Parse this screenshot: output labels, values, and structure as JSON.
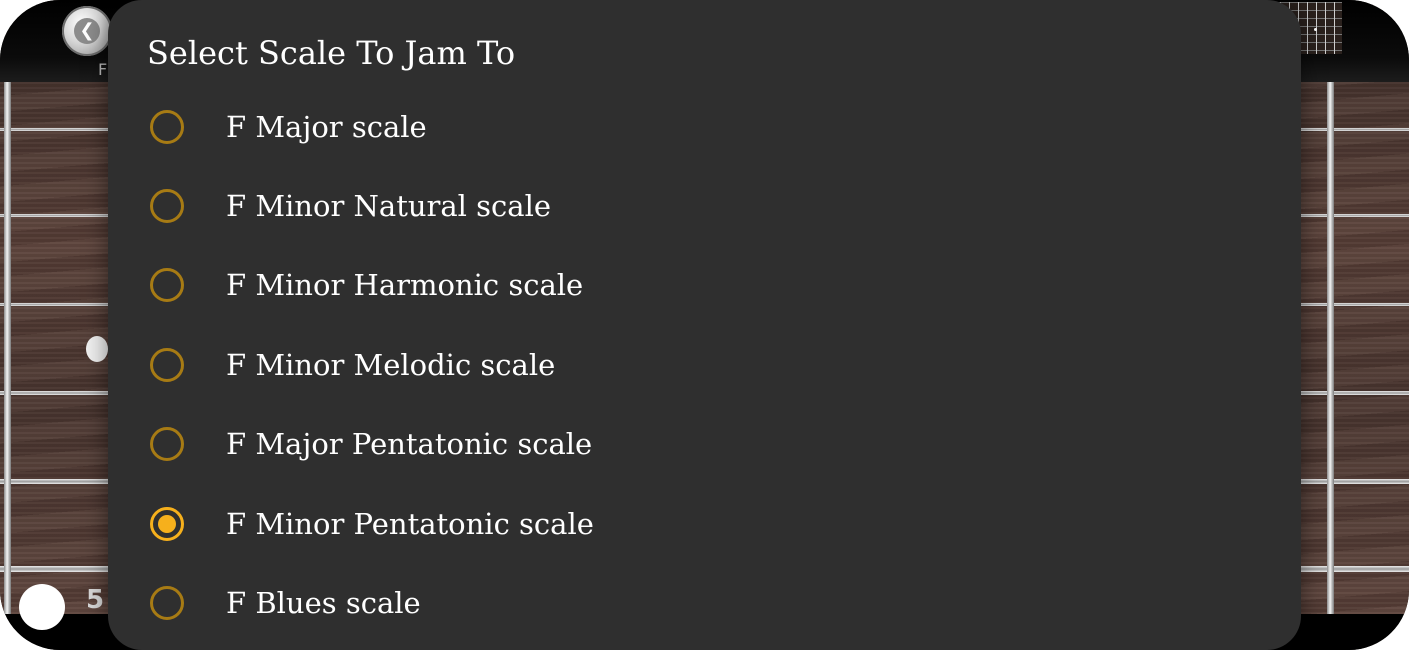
{
  "background_app": {
    "back_button_label_fragment": "F",
    "fret_number": "5"
  },
  "dialog": {
    "title": "Select Scale To Jam To",
    "options": [
      {
        "label": "F Major scale",
        "selected": false
      },
      {
        "label": "F Minor Natural scale",
        "selected": false
      },
      {
        "label": "F Minor Harmonic scale",
        "selected": false
      },
      {
        "label": "F Minor Melodic scale",
        "selected": false
      },
      {
        "label": "F Major Pentatonic scale",
        "selected": false
      },
      {
        "label": "F Minor Pentatonic scale",
        "selected": true
      },
      {
        "label": "F Blues scale",
        "selected": false
      }
    ]
  },
  "colors": {
    "dialog_background": "#2f2f2f",
    "radio_unselected": "#a77b14",
    "radio_selected": "#f6b01c",
    "text": "#ffffff"
  }
}
